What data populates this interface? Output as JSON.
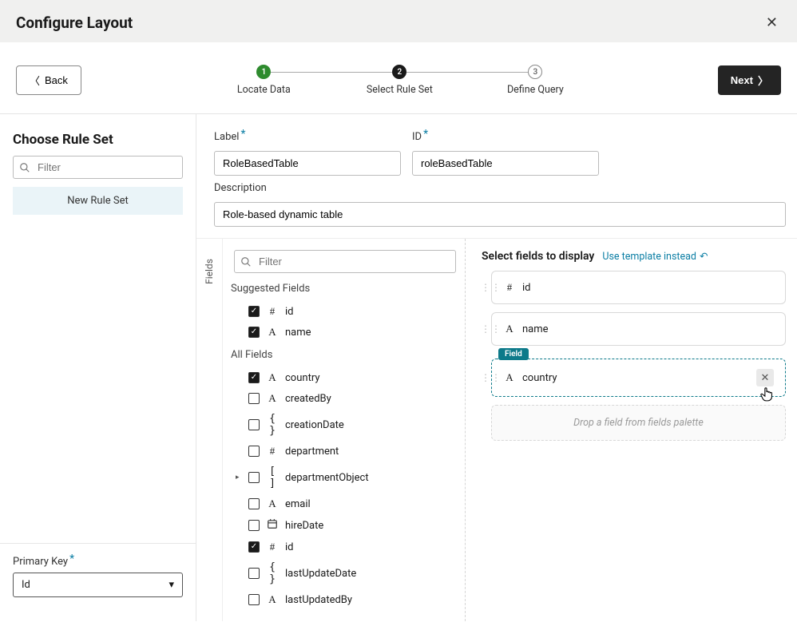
{
  "header": {
    "title": "Configure Layout"
  },
  "wizard": {
    "back": "Back",
    "next": "Next",
    "steps": {
      "s1": {
        "num": "1",
        "label": "Locate Data"
      },
      "s2": {
        "num": "2",
        "label": "Select Rule Set"
      },
      "s3": {
        "num": "3",
        "label": "Define Query"
      }
    }
  },
  "sidebar": {
    "heading": "Choose Rule Set",
    "filterPlaceholder": "Filter",
    "newRuleSet": "New Rule Set",
    "primaryKeyLabel": "Primary Key",
    "primaryKeyValue": "Id"
  },
  "form": {
    "labelLabel": "Label",
    "labelValue": "RoleBasedTable",
    "idLabel": "ID",
    "idValue": "roleBasedTable",
    "descLabel": "Description",
    "descValue": "Role-based dynamic table"
  },
  "palette": {
    "tabLabel": "Fields",
    "filterPlaceholder": "Filter",
    "suggestedHeading": "Suggested Fields",
    "allHeading": "All Fields",
    "suggested": {
      "id": {
        "label": "id",
        "type": "#"
      },
      "name": {
        "label": "name",
        "type": "A"
      }
    },
    "all": {
      "country": {
        "label": "country",
        "type": "A"
      },
      "createdBy": {
        "label": "createdBy",
        "type": "A"
      },
      "creationDate": {
        "label": "creationDate",
        "type": "{}"
      },
      "department": {
        "label": "department",
        "type": "#"
      },
      "departmentObject": {
        "label": "departmentObject",
        "type": "[]"
      },
      "email": {
        "label": "email",
        "type": "A"
      },
      "hireDate": {
        "label": "hireDate",
        "type": "cal"
      },
      "id": {
        "label": "id",
        "type": "#"
      },
      "lastUpdateDate": {
        "label": "lastUpdateDate",
        "type": "{}"
      },
      "lastUpdatedBy": {
        "label": "lastUpdatedBy",
        "type": "A"
      }
    }
  },
  "canvas": {
    "heading": "Select fields to display",
    "templateLink": "Use template instead",
    "badge": "Field",
    "dropHint": "Drop a field from fields palette",
    "slots": {
      "id": {
        "label": "id",
        "type": "#"
      },
      "name": {
        "label": "name",
        "type": "A"
      },
      "country": {
        "label": "country",
        "type": "A"
      }
    }
  }
}
